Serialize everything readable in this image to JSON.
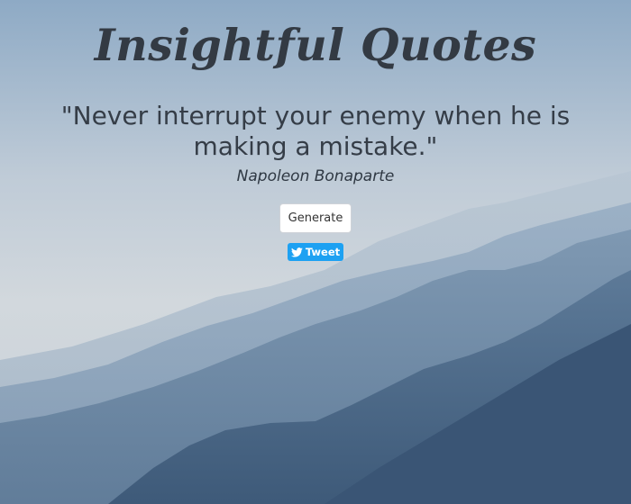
{
  "header": {
    "title": "Insightful Quotes"
  },
  "quote": {
    "text": "\"Never interrupt your enemy when he is making a mistake.\"",
    "author": "Napoleon Bonaparte"
  },
  "actions": {
    "generate_label": "Generate",
    "tweet_label": "Tweet",
    "tweet_icon": "twitter-bird-icon"
  },
  "theme": {
    "sky_top": "#8ea9c3",
    "sky_mid": "#c3cdd6",
    "mountain_far": "#a9b9c9",
    "mountain_mid": "#7f97b0",
    "mountain_near": "#4a6684",
    "text_color": "#333a43",
    "tweet_blue": "#1da1f2"
  }
}
